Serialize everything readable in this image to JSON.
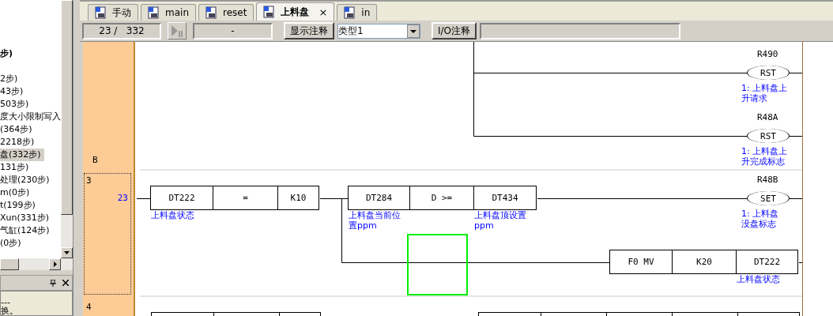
{
  "sidebar": {
    "items": [
      {
        "label": "步)",
        "selected": false,
        "bold": true
      },
      {
        "label": "2步)",
        "selected": false,
        "bold": false
      },
      {
        "label": "43步)",
        "selected": false,
        "bold": false
      },
      {
        "label": "503步)",
        "selected": false,
        "bold": false
      },
      {
        "label": "度大小限制写入",
        "selected": false,
        "bold": false
      },
      {
        "label": "(364步)",
        "selected": false,
        "bold": false
      },
      {
        "label": "2218步)",
        "selected": false,
        "bold": false
      },
      {
        "label": "盘(332步)",
        "selected": true,
        "bold": false
      },
      {
        "label": "131步)",
        "selected": false,
        "bold": false
      },
      {
        "label": "处理(230步)",
        "selected": false,
        "bold": false
      },
      {
        "label": "m(0步)",
        "selected": false,
        "bold": false
      },
      {
        "label": "t(199步)",
        "selected": false,
        "bold": false
      },
      {
        "label": "Xun(331步)",
        "selected": false,
        "bold": false
      },
      {
        "label": "气缸(124步)",
        "selected": false,
        "bold": false
      },
      {
        "label": "(0步)",
        "selected": false,
        "bold": false
      }
    ],
    "panel": {
      "lines": [
        "---",
        "换。"
      ]
    }
  },
  "tabs": [
    {
      "label": "手动",
      "selected": false
    },
    {
      "label": "main",
      "selected": false
    },
    {
      "label": "reset",
      "selected": false
    },
    {
      "label": "上料盘",
      "selected": true,
      "close": "×"
    },
    {
      "label": "in",
      "selected": false
    }
  ],
  "toolbar": {
    "position": "23 /   332",
    "status": "-",
    "comment_button": "显示注释",
    "type_select": "类型1",
    "io_button": "I/O注释"
  },
  "rungs": [
    {
      "label": "B",
      "selected": false,
      "coils": [
        {
          "device": "R490",
          "op": "RST",
          "comment": [
            "1: 上料盘上",
            "升请求"
          ]
        },
        {
          "device": "R48A",
          "op": "RST",
          "comment": [
            "1: 上料盘上",
            "升完成标志"
          ]
        }
      ]
    },
    {
      "label": "3",
      "step": "23",
      "selected": true,
      "blocks": [
        {
          "cells": [
            {
              "text": "DT222",
              "comment": [
                "上料盘状态"
              ]
            },
            {
              "text": "="
            },
            {
              "text": "K10"
            }
          ]
        },
        {
          "cells": [
            {
              "text": "DT284",
              "comment": [
                "上料盘当前位",
                "置ppm"
              ]
            },
            {
              "text": "D >="
            },
            {
              "text": "DT434",
              "comment": [
                "上料盘顶设置",
                "ppm"
              ]
            }
          ]
        },
        {
          "cells": [
            {
              "text": "F0 MV"
            },
            {
              "text": "K20"
            },
            {
              "text": "DT222",
              "comment": [
                "上料盘状态"
              ]
            }
          ]
        }
      ],
      "coils": [
        {
          "device": "R48B",
          "op": "SET",
          "comment": [
            "1: 上料盘",
            "没盘标志"
          ]
        }
      ]
    },
    {
      "label": "4",
      "selected": false
    }
  ]
}
